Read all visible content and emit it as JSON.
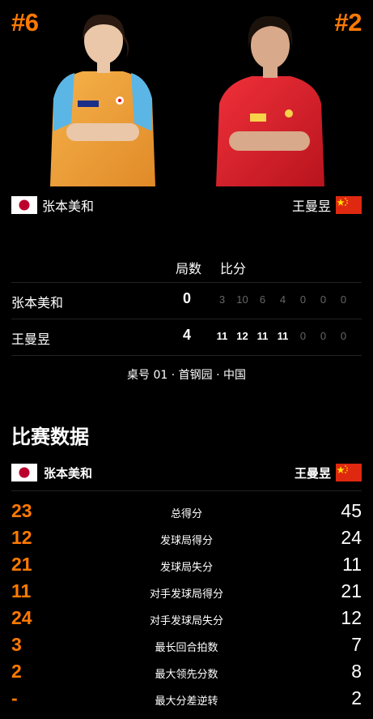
{
  "player1": {
    "seed": "#6",
    "name": "张本美和",
    "country": "Japan",
    "flag_icon": "japan-flag-icon",
    "games_won": "0",
    "points": [
      "3",
      "10",
      "6",
      "4",
      "0",
      "0",
      "0"
    ]
  },
  "player2": {
    "seed": "#2",
    "name": "王曼昱",
    "country": "China",
    "flag_icon": "china-flag-icon",
    "games_won": "4",
    "points": [
      "11",
      "12",
      "11",
      "11",
      "0",
      "0",
      "0"
    ]
  },
  "score_table": {
    "games_header": "局数",
    "points_header": "比分"
  },
  "venue": "桌号 01 · 首钢园 · 中国",
  "stats": {
    "title": "比赛数据",
    "rows": [
      {
        "label": "总得分",
        "left": "23",
        "right": "45"
      },
      {
        "label": "发球局得分",
        "left": "12",
        "right": "24"
      },
      {
        "label": "发球局失分",
        "left": "21",
        "right": "11"
      },
      {
        "label": "对手发球局得分",
        "left": "11",
        "right": "21"
      },
      {
        "label": "对手发球局失分",
        "left": "24",
        "right": "12"
      },
      {
        "label": "最长回合拍数",
        "left": "3",
        "right": "7"
      },
      {
        "label": "最大领先分数",
        "left": "2",
        "right": "8"
      },
      {
        "label": "最大分差逆转",
        "left": "-",
        "right": "2"
      }
    ]
  },
  "colors": {
    "accent": "#ff7a00",
    "background": "#000000",
    "p1_shirt": "#f0a040",
    "p2_shirt": "#e0202a"
  }
}
